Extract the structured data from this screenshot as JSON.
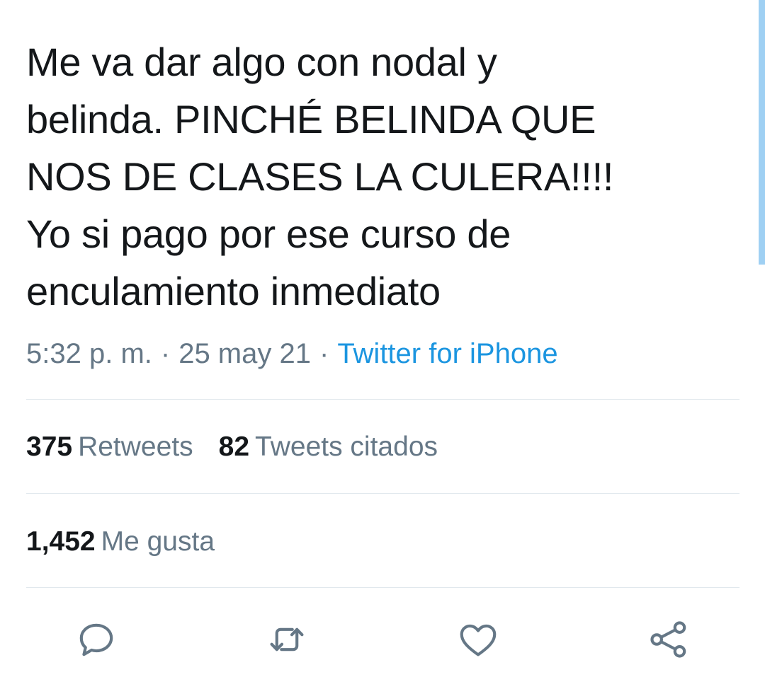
{
  "tweet": {
    "text": "Me va dar algo con nodal y\nbelinda. PINCHÉ BELINDA QUE\nNOS DE CLASES LA CULERA!!!!\nYo si pago por ese curso de\nenculamiento inmediato",
    "time": "5:32 p. m.",
    "separator": "·",
    "date": "25 may 21",
    "source": "Twitter for iPhone"
  },
  "stats": {
    "retweets_count": "375",
    "retweets_label": "Retweets",
    "quotes_count": "82",
    "quotes_label": "Tweets citados",
    "likes_count": "1,452",
    "likes_label": "Me gusta"
  },
  "actions": [
    {
      "icon": "reply-icon"
    },
    {
      "icon": "retweet-icon"
    },
    {
      "icon": "heart-icon"
    },
    {
      "icon": "share-icon"
    }
  ],
  "colors": {
    "text": "#14171a",
    "secondary": "#657786",
    "link": "#1b95e0",
    "divider": "#e1e8ed",
    "scrollbar": "#9fd0f3"
  }
}
